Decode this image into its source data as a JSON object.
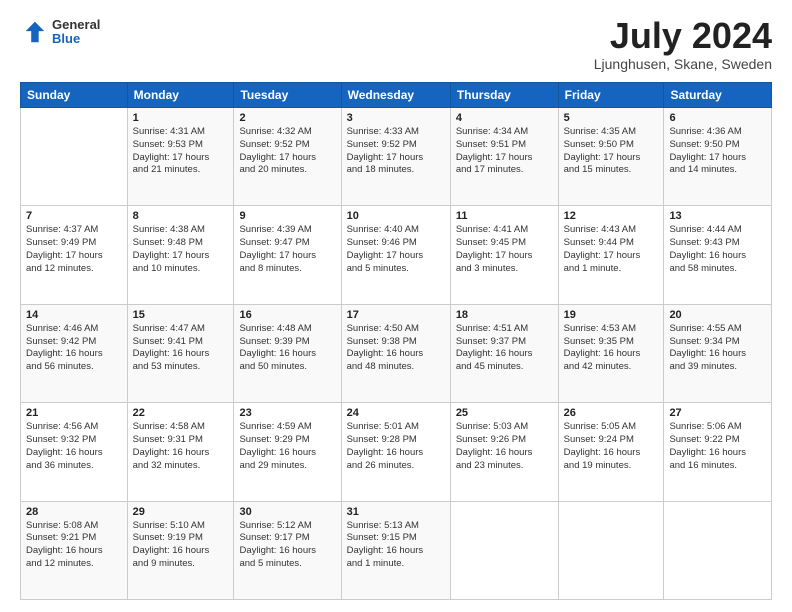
{
  "header": {
    "logo_general": "General",
    "logo_blue": "Blue",
    "month_title": "July 2024",
    "location": "Ljunghusen, Skane, Sweden"
  },
  "days_of_week": [
    "Sunday",
    "Monday",
    "Tuesday",
    "Wednesday",
    "Thursday",
    "Friday",
    "Saturday"
  ],
  "weeks": [
    [
      {
        "day": "",
        "info": ""
      },
      {
        "day": "1",
        "info": "Sunrise: 4:31 AM\nSunset: 9:53 PM\nDaylight: 17 hours\nand 21 minutes."
      },
      {
        "day": "2",
        "info": "Sunrise: 4:32 AM\nSunset: 9:52 PM\nDaylight: 17 hours\nand 20 minutes."
      },
      {
        "day": "3",
        "info": "Sunrise: 4:33 AM\nSunset: 9:52 PM\nDaylight: 17 hours\nand 18 minutes."
      },
      {
        "day": "4",
        "info": "Sunrise: 4:34 AM\nSunset: 9:51 PM\nDaylight: 17 hours\nand 17 minutes."
      },
      {
        "day": "5",
        "info": "Sunrise: 4:35 AM\nSunset: 9:50 PM\nDaylight: 17 hours\nand 15 minutes."
      },
      {
        "day": "6",
        "info": "Sunrise: 4:36 AM\nSunset: 9:50 PM\nDaylight: 17 hours\nand 14 minutes."
      }
    ],
    [
      {
        "day": "7",
        "info": "Sunrise: 4:37 AM\nSunset: 9:49 PM\nDaylight: 17 hours\nand 12 minutes."
      },
      {
        "day": "8",
        "info": "Sunrise: 4:38 AM\nSunset: 9:48 PM\nDaylight: 17 hours\nand 10 minutes."
      },
      {
        "day": "9",
        "info": "Sunrise: 4:39 AM\nSunset: 9:47 PM\nDaylight: 17 hours\nand 8 minutes."
      },
      {
        "day": "10",
        "info": "Sunrise: 4:40 AM\nSunset: 9:46 PM\nDaylight: 17 hours\nand 5 minutes."
      },
      {
        "day": "11",
        "info": "Sunrise: 4:41 AM\nSunset: 9:45 PM\nDaylight: 17 hours\nand 3 minutes."
      },
      {
        "day": "12",
        "info": "Sunrise: 4:43 AM\nSunset: 9:44 PM\nDaylight: 17 hours\nand 1 minute."
      },
      {
        "day": "13",
        "info": "Sunrise: 4:44 AM\nSunset: 9:43 PM\nDaylight: 16 hours\nand 58 minutes."
      }
    ],
    [
      {
        "day": "14",
        "info": "Sunrise: 4:46 AM\nSunset: 9:42 PM\nDaylight: 16 hours\nand 56 minutes."
      },
      {
        "day": "15",
        "info": "Sunrise: 4:47 AM\nSunset: 9:41 PM\nDaylight: 16 hours\nand 53 minutes."
      },
      {
        "day": "16",
        "info": "Sunrise: 4:48 AM\nSunset: 9:39 PM\nDaylight: 16 hours\nand 50 minutes."
      },
      {
        "day": "17",
        "info": "Sunrise: 4:50 AM\nSunset: 9:38 PM\nDaylight: 16 hours\nand 48 minutes."
      },
      {
        "day": "18",
        "info": "Sunrise: 4:51 AM\nSunset: 9:37 PM\nDaylight: 16 hours\nand 45 minutes."
      },
      {
        "day": "19",
        "info": "Sunrise: 4:53 AM\nSunset: 9:35 PM\nDaylight: 16 hours\nand 42 minutes."
      },
      {
        "day": "20",
        "info": "Sunrise: 4:55 AM\nSunset: 9:34 PM\nDaylight: 16 hours\nand 39 minutes."
      }
    ],
    [
      {
        "day": "21",
        "info": "Sunrise: 4:56 AM\nSunset: 9:32 PM\nDaylight: 16 hours\nand 36 minutes."
      },
      {
        "day": "22",
        "info": "Sunrise: 4:58 AM\nSunset: 9:31 PM\nDaylight: 16 hours\nand 32 minutes."
      },
      {
        "day": "23",
        "info": "Sunrise: 4:59 AM\nSunset: 9:29 PM\nDaylight: 16 hours\nand 29 minutes."
      },
      {
        "day": "24",
        "info": "Sunrise: 5:01 AM\nSunset: 9:28 PM\nDaylight: 16 hours\nand 26 minutes."
      },
      {
        "day": "25",
        "info": "Sunrise: 5:03 AM\nSunset: 9:26 PM\nDaylight: 16 hours\nand 23 minutes."
      },
      {
        "day": "26",
        "info": "Sunrise: 5:05 AM\nSunset: 9:24 PM\nDaylight: 16 hours\nand 19 minutes."
      },
      {
        "day": "27",
        "info": "Sunrise: 5:06 AM\nSunset: 9:22 PM\nDaylight: 16 hours\nand 16 minutes."
      }
    ],
    [
      {
        "day": "28",
        "info": "Sunrise: 5:08 AM\nSunset: 9:21 PM\nDaylight: 16 hours\nand 12 minutes."
      },
      {
        "day": "29",
        "info": "Sunrise: 5:10 AM\nSunset: 9:19 PM\nDaylight: 16 hours\nand 9 minutes."
      },
      {
        "day": "30",
        "info": "Sunrise: 5:12 AM\nSunset: 9:17 PM\nDaylight: 16 hours\nand 5 minutes."
      },
      {
        "day": "31",
        "info": "Sunrise: 5:13 AM\nSunset: 9:15 PM\nDaylight: 16 hours\nand 1 minute."
      },
      {
        "day": "",
        "info": ""
      },
      {
        "day": "",
        "info": ""
      },
      {
        "day": "",
        "info": ""
      }
    ]
  ]
}
